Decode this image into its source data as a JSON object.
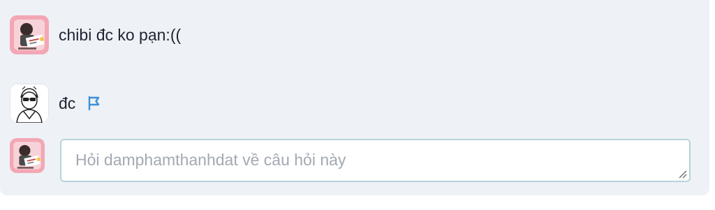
{
  "thread": {
    "comments": [
      {
        "text": "chibi đc ko pạn:((",
        "avatar": "user-avatar-pink"
      },
      {
        "text": "đc",
        "avatar": "user-avatar-sketch",
        "flag_icon": "flag-icon"
      }
    ],
    "reply": {
      "placeholder": "Hỏi damphamthanhdat về câu hỏi này",
      "value": ""
    }
  },
  "colors": {
    "thread_bg": "#eef1f6",
    "text": "#1f2430",
    "placeholder": "#a3a9b2",
    "input_border": "#b7d3dc",
    "flag": "#3d8fd8",
    "avatar_pink": "#f3a7b4"
  }
}
